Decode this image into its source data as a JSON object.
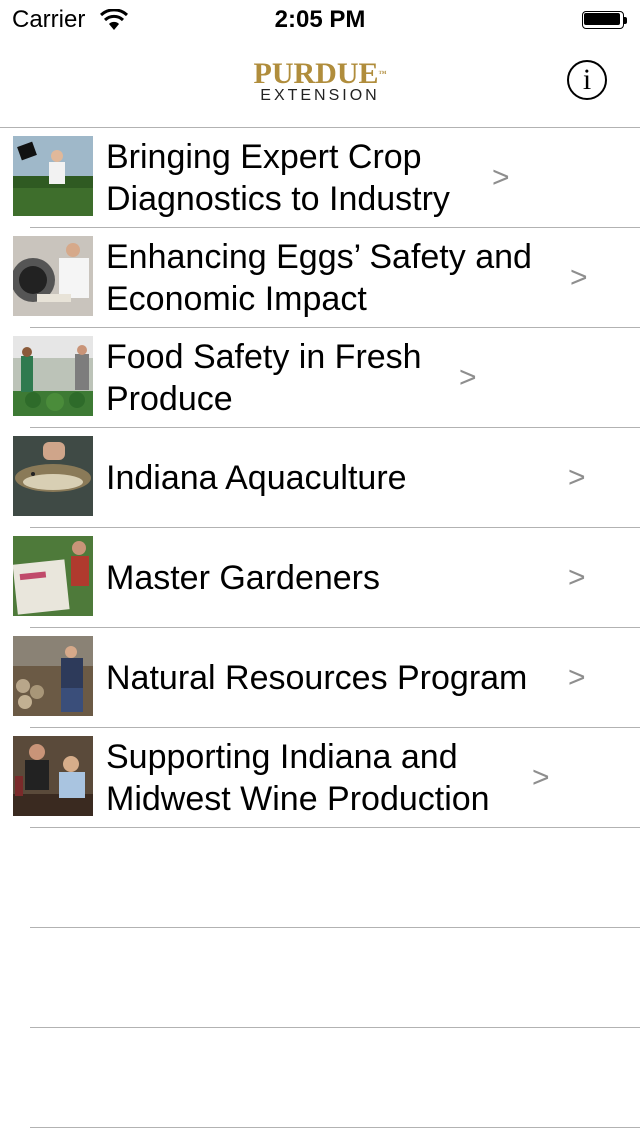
{
  "status_bar": {
    "carrier": "Carrier",
    "time": "2:05 PM"
  },
  "nav": {
    "logo_top": "PURDUE",
    "logo_tm": "™",
    "logo_bottom": "EXTENSION",
    "info_label": "i"
  },
  "programs": [
    {
      "title": "Bringing Expert Crop Diagnostics to Industry",
      "chevron": ">"
    },
    {
      "title": "Enhancing Eggs’ Safety and Economic Impact",
      "chevron": ">"
    },
    {
      "title": "Food Safety in Fresh Produce",
      "chevron": ">"
    },
    {
      "title": "Indiana Aquaculture",
      "chevron": ">"
    },
    {
      "title": "Master Gardeners",
      "chevron": ">"
    },
    {
      "title": "Natural Resources Program",
      "chevron": ">"
    },
    {
      "title": "Supporting Indiana and Midwest Wine Production",
      "chevron": ">"
    }
  ]
}
